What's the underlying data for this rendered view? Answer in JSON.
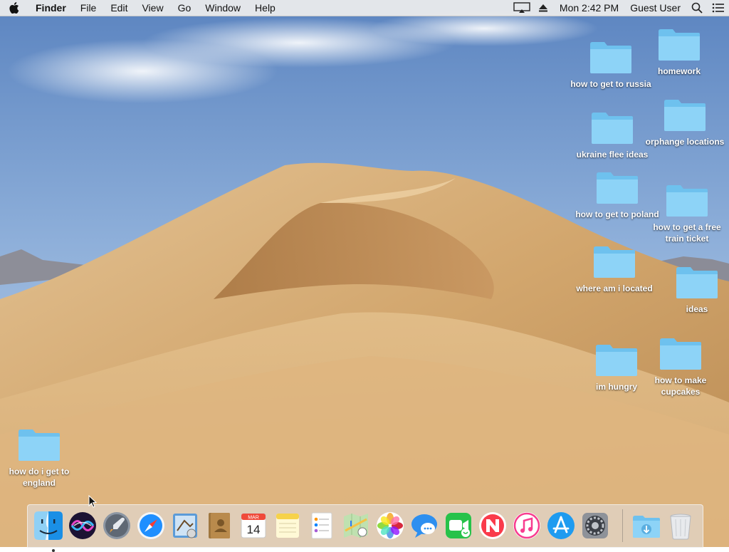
{
  "menubar": {
    "app_name": "Finder",
    "menus": [
      "File",
      "Edit",
      "View",
      "Go",
      "Window",
      "Help"
    ],
    "clock": "Mon 2:42 PM",
    "user": "Guest User"
  },
  "desktop": {
    "folders": [
      {
        "label": "homework"
      },
      {
        "label": "how to get to russia"
      },
      {
        "label": "orphange locations"
      },
      {
        "label": "ukraine flee ideas"
      },
      {
        "label": "how to get to poland"
      },
      {
        "label": "how to get a free train ticket"
      },
      {
        "label": "where am i located"
      },
      {
        "label": "ideas"
      },
      {
        "label": "how to make cupcakes"
      },
      {
        "label": "im hungry"
      },
      {
        "label": "how do i get to england"
      }
    ]
  },
  "dock": {
    "apps": [
      {
        "name": "finder-icon"
      },
      {
        "name": "siri-icon"
      },
      {
        "name": "launchpad-icon"
      },
      {
        "name": "safari-icon"
      },
      {
        "name": "mail-icon"
      },
      {
        "name": "contacts-icon"
      },
      {
        "name": "calendar-icon",
        "month": "MAR",
        "day": "14"
      },
      {
        "name": "notes-icon"
      },
      {
        "name": "reminders-icon"
      },
      {
        "name": "maps-icon"
      },
      {
        "name": "photos-icon"
      },
      {
        "name": "messages-icon"
      },
      {
        "name": "facetime-icon"
      },
      {
        "name": "news-icon"
      },
      {
        "name": "itunes-icon"
      },
      {
        "name": "app-store-icon"
      },
      {
        "name": "system-preferences-icon"
      },
      {
        "name": "downloads-folder-icon"
      },
      {
        "name": "trash-icon"
      }
    ]
  }
}
